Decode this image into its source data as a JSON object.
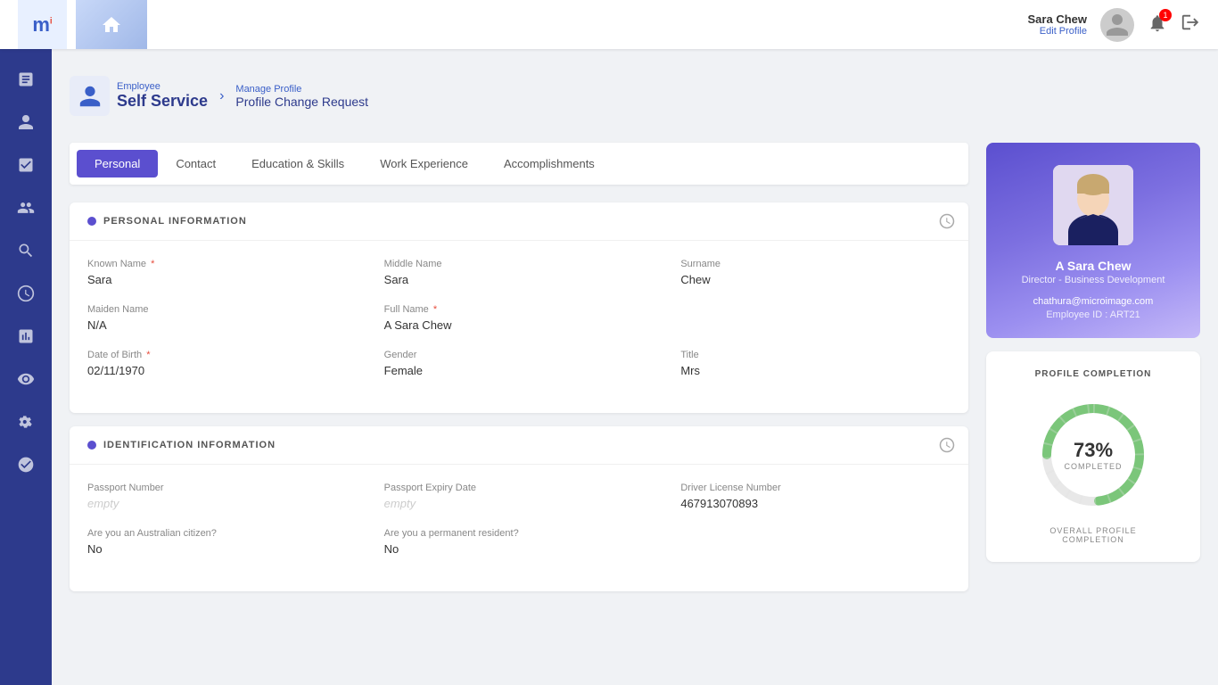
{
  "header": {
    "user_name": "Sara Chew",
    "edit_profile_label": "Edit Profile",
    "notif_count": "1"
  },
  "breadcrumb": {
    "employee_label": "Employee",
    "self_service_label": "Self Service",
    "manage_profile_label": "Manage Profile",
    "page_title": "Profile Change Request"
  },
  "tabs": [
    {
      "id": "personal",
      "label": "Personal",
      "active": true
    },
    {
      "id": "contact",
      "label": "Contact",
      "active": false
    },
    {
      "id": "education",
      "label": "Education & Skills",
      "active": false
    },
    {
      "id": "work",
      "label": "Work Experience",
      "active": false
    },
    {
      "id": "accomplishments",
      "label": "Accomplishments",
      "active": false
    }
  ],
  "personal_section": {
    "title": "PERSONAL INFORMATION",
    "fields": [
      {
        "label": "Known Name",
        "required": true,
        "value": "Sara"
      },
      {
        "label": "Middle Name",
        "required": false,
        "value": "Sara"
      },
      {
        "label": "Surname",
        "required": false,
        "value": "Chew"
      },
      {
        "label": "Maiden Name",
        "required": false,
        "value": "N/A"
      },
      {
        "label": "Full Name",
        "required": true,
        "value": "A Sara Chew"
      },
      {
        "label": "Date of Birth",
        "required": true,
        "value": "02/11/1970"
      },
      {
        "label": "Gender",
        "required": false,
        "value": "Female"
      },
      {
        "label": "Title",
        "required": false,
        "value": "Mrs"
      }
    ]
  },
  "identification_section": {
    "title": "IDENTIFICATION INFORMATION",
    "fields": [
      {
        "label": "Passport Number",
        "required": false,
        "value": "",
        "empty": true
      },
      {
        "label": "Passport Expiry Date",
        "required": false,
        "value": "",
        "empty": true
      },
      {
        "label": "Driver License Number",
        "required": false,
        "value": "467913070893"
      },
      {
        "label": "Are you an Australian citizen?",
        "required": false,
        "value": "No"
      },
      {
        "label": "Are you a permanent resident?",
        "required": false,
        "value": "No"
      }
    ]
  },
  "profile_card": {
    "name": "A Sara Chew",
    "title": "Director - Business Development",
    "email": "chathura@microimage.com",
    "emp_id_label": "Employee ID : ART21"
  },
  "completion": {
    "title": "PROFILE COMPLETION",
    "percent": "73%",
    "completed_label": "COMPLETED",
    "footer_label": "OVERALL PROFILE",
    "footer_label2": "COMPLETION",
    "value": 73
  },
  "sidebar": {
    "items": [
      {
        "icon": "📋",
        "name": "forms-icon"
      },
      {
        "icon": "👤",
        "name": "employee-icon"
      },
      {
        "icon": "📝",
        "name": "tasks-icon"
      },
      {
        "icon": "👥",
        "name": "team-icon"
      },
      {
        "icon": "🔍",
        "name": "search-icon"
      },
      {
        "icon": "⚙️",
        "name": "settings-icon"
      },
      {
        "icon": "🔔",
        "name": "notifications-icon"
      },
      {
        "icon": "📊",
        "name": "reports-icon"
      },
      {
        "icon": "👁️",
        "name": "view-icon"
      }
    ]
  }
}
